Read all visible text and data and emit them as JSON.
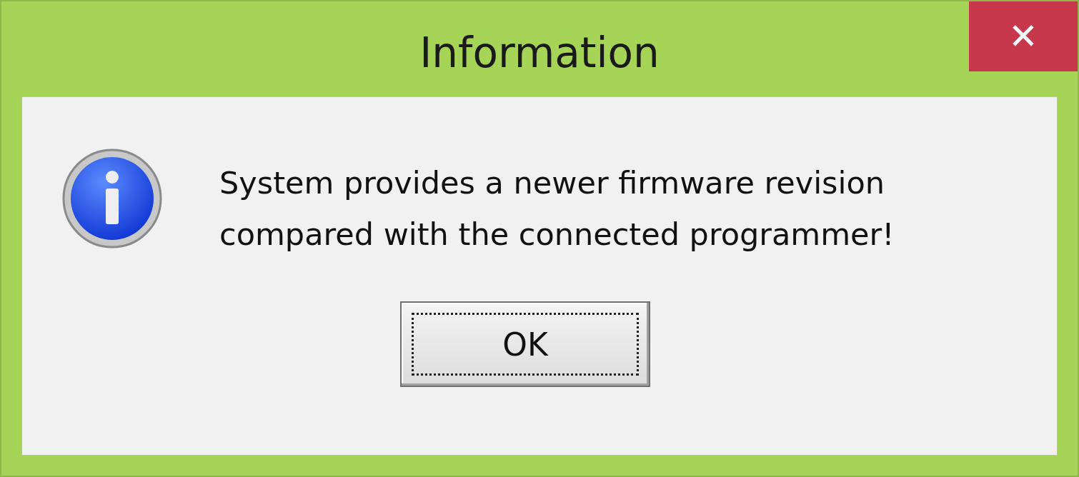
{
  "window": {
    "title": "Information",
    "close": "✕"
  },
  "message": {
    "lines": [
      "System provides a newer firmware revision",
      "compared with the connected programmer!"
    ]
  },
  "buttons": [
    {
      "label": "OK",
      "focused": true
    }
  ]
}
